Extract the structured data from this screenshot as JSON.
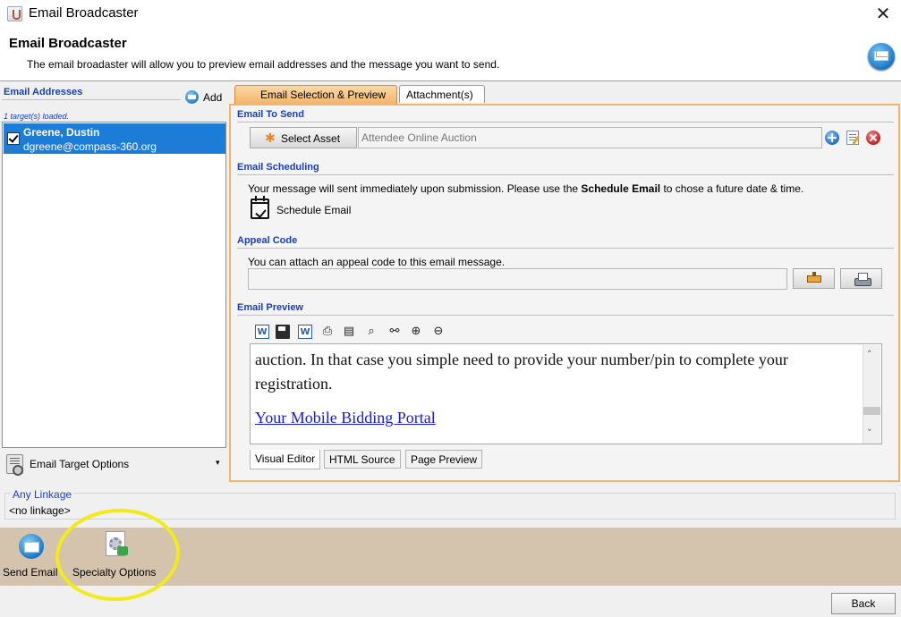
{
  "window": {
    "title": "Email Broadcaster",
    "close_glyph": "✕"
  },
  "header": {
    "title": "Email Broadcaster",
    "description": "The email broadaster will allow you to preview email addresses and the message you want to send."
  },
  "left_panel": {
    "section_label": "Email Addresses",
    "add_label": "Add",
    "loaded_status": "1 target(s) loaded.",
    "targets": [
      {
        "name": "Greene, Dustin",
        "email": "dgreene@compass-360.org",
        "checked": true,
        "selected": true
      }
    ],
    "options_label": "Email Target Options",
    "options_caret": "▾"
  },
  "tabs": [
    {
      "label": "Email Selection & Preview",
      "active": true
    },
    {
      "label": "Attachment(s)",
      "active": false
    }
  ],
  "email_to_send": {
    "section_title": "Email To Send",
    "select_button_label": "Select Asset",
    "asset_value": "Attendee Online Auction"
  },
  "scheduling": {
    "section_title": "Email Scheduling",
    "text_before": "Your message will sent immediately upon submission. Please use the ",
    "text_bold": "Schedule Email",
    "text_after": " to chose a future date & time.",
    "button_label": "Schedule Email"
  },
  "appeal": {
    "section_title": "Appeal Code",
    "text": "You can attach an appeal code to this email message.",
    "value": ""
  },
  "preview": {
    "section_title": "Email Preview",
    "toolbar_icons": [
      "word-icon",
      "save-icon",
      "word-export-icon",
      "print-icon",
      "document-icon",
      "print-preview-icon",
      "find-icon",
      "zoom-in-icon",
      "zoom-out-icon"
    ],
    "body_text": "auction.  In that case you simple need to provide your number/pin to complete your registration.",
    "link_text": "Your Mobile Bidding Portal",
    "tabs": [
      "Visual Editor",
      "HTML Source",
      "Page Preview"
    ],
    "active_tab": "Visual Editor"
  },
  "linkage": {
    "label": "Any Linkage",
    "value": "<no linkage>"
  },
  "bottom_toolbar": {
    "send_label": "Send Email",
    "specialty_label": "Specialty Options",
    "highlight_color": "#f2ea1c"
  },
  "footer": {
    "back_label": "Back"
  },
  "colors": {
    "accent_blue": "#1a3fb0",
    "selection": "#1d7dd6",
    "tab_orange": "#f7b36b",
    "bottom_bar": "#d4c4ad"
  }
}
